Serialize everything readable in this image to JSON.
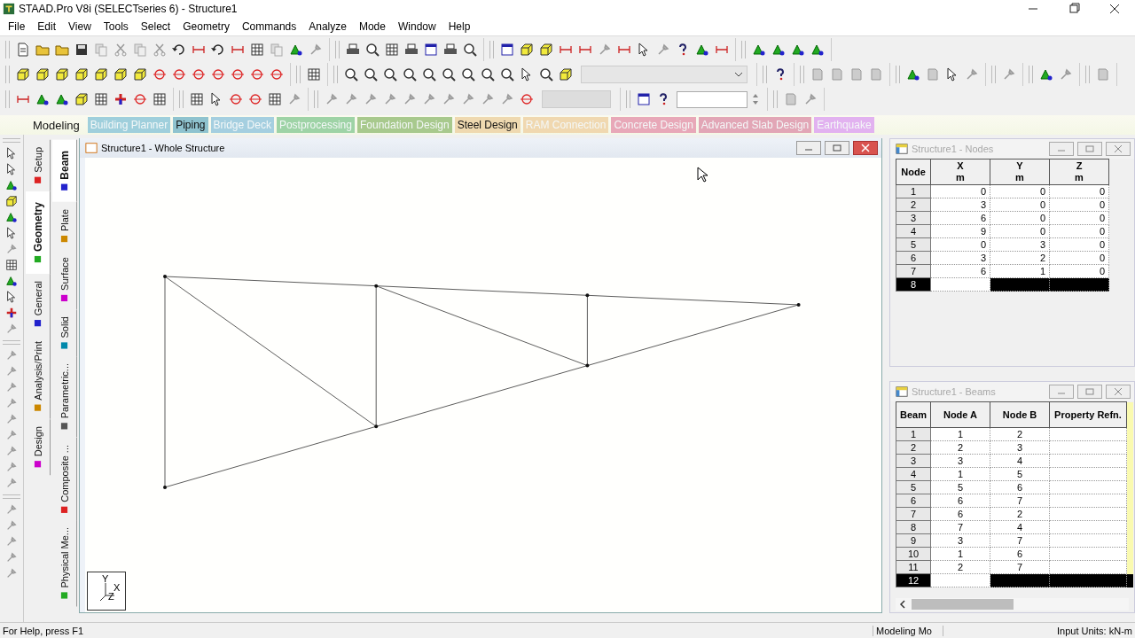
{
  "window": {
    "title": "STAAD.Pro V8i (SELECTseries 6) - Structure1"
  },
  "menu": [
    "File",
    "Edit",
    "View",
    "Tools",
    "Select",
    "Geometry",
    "Commands",
    "Analyze",
    "Mode",
    "Window",
    "Help"
  ],
  "workflow_tabs": [
    {
      "label": "Modeling",
      "selected": true,
      "disabled": false
    },
    {
      "label": "Building Planner",
      "selected": false,
      "disabled": true,
      "color": "#9fcfdc"
    },
    {
      "label": "Piping",
      "selected": false,
      "disabled": false,
      "color": "#8fc3cf"
    },
    {
      "label": "Bridge Deck",
      "selected": false,
      "disabled": true,
      "color": "#a5cfe0"
    },
    {
      "label": "Postprocessing",
      "selected": false,
      "disabled": true,
      "color": "#9ed3a6"
    },
    {
      "label": "Foundation Design",
      "selected": false,
      "disabled": true,
      "color": "#a8c98d"
    },
    {
      "label": "Steel Design",
      "selected": false,
      "disabled": false,
      "color": "#efd9b0"
    },
    {
      "label": "RAM Connection",
      "selected": false,
      "disabled": true,
      "color": "#f0d8b0"
    },
    {
      "label": "Concrete Design",
      "selected": false,
      "disabled": true,
      "color": "#e8a8b8"
    },
    {
      "label": "Advanced Slab Design",
      "selected": false,
      "disabled": true,
      "color": "#e2a6b6"
    },
    {
      "label": "Earthquake",
      "selected": false,
      "disabled": true,
      "color": "#e2b2f0"
    }
  ],
  "page_tabs": [
    {
      "label": "Setup",
      "selected": false
    },
    {
      "label": "Geometry",
      "selected": true
    },
    {
      "label": "General",
      "selected": false
    },
    {
      "label": "Analysis/Print",
      "selected": false
    },
    {
      "label": "Design",
      "selected": false
    }
  ],
  "sub_tabs": [
    {
      "label": "Beam",
      "selected": true
    },
    {
      "label": "Plate",
      "selected": false
    },
    {
      "label": "Surface",
      "selected": false
    },
    {
      "label": "Solid",
      "selected": false
    },
    {
      "label": "Parametric...",
      "selected": false
    },
    {
      "label": "Composite ...",
      "selected": false
    },
    {
      "label": "Physical Me...",
      "selected": false
    }
  ],
  "viewport": {
    "title": "Structure1 - Whole Structure",
    "axis_labels": [
      "Y",
      "X",
      "Z"
    ]
  },
  "nodes_table": {
    "title": "Structure1 - Nodes",
    "columns": [
      {
        "label": "Node"
      },
      {
        "label": "X",
        "unit": "m"
      },
      {
        "label": "Y",
        "unit": "m"
      },
      {
        "label": "Z",
        "unit": "m"
      }
    ],
    "rows": [
      {
        "id": "1",
        "values": [
          "0",
          "0",
          "0"
        ],
        "selected": false
      },
      {
        "id": "2",
        "values": [
          "3",
          "0",
          "0"
        ],
        "selected": false
      },
      {
        "id": "3",
        "values": [
          "6",
          "0",
          "0"
        ],
        "selected": false
      },
      {
        "id": "4",
        "values": [
          "9",
          "0",
          "0"
        ],
        "selected": false
      },
      {
        "id": "5",
        "values": [
          "0",
          "3",
          "0"
        ],
        "selected": false
      },
      {
        "id": "6",
        "values": [
          "3",
          "2",
          "0"
        ],
        "selected": false
      },
      {
        "id": "7",
        "values": [
          "6",
          "1",
          "0"
        ],
        "selected": false
      },
      {
        "id": "8",
        "selected": true
      }
    ]
  },
  "beams_table": {
    "title": "Structure1 - Beams",
    "columns": [
      {
        "label": "Beam"
      },
      {
        "label": "Node A"
      },
      {
        "label": "Node B"
      },
      {
        "label": "Property Refn."
      }
    ],
    "rows": [
      {
        "id": "1",
        "values": [
          "1",
          "2"
        ],
        "selected": false
      },
      {
        "id": "2",
        "values": [
          "2",
          "3"
        ],
        "selected": false
      },
      {
        "id": "3",
        "values": [
          "3",
          "4"
        ],
        "selected": false
      },
      {
        "id": "4",
        "values": [
          "1",
          "5"
        ],
        "selected": false
      },
      {
        "id": "5",
        "values": [
          "5",
          "6"
        ],
        "selected": false
      },
      {
        "id": "6",
        "values": [
          "6",
          "7"
        ],
        "selected": false
      },
      {
        "id": "7",
        "values": [
          "6",
          "2"
        ],
        "selected": false
      },
      {
        "id": "8",
        "values": [
          "7",
          "4"
        ],
        "selected": false
      },
      {
        "id": "9",
        "values": [
          "3",
          "7"
        ],
        "selected": false
      },
      {
        "id": "10",
        "values": [
          "1",
          "6"
        ],
        "selected": false
      },
      {
        "id": "11",
        "values": [
          "2",
          "7"
        ],
        "selected": false
      },
      {
        "id": "12",
        "selected": true
      }
    ]
  },
  "status_bar": {
    "help": "For Help, press F1",
    "mode": "Modeling Mo",
    "units": "Input Units:  kN-m"
  }
}
